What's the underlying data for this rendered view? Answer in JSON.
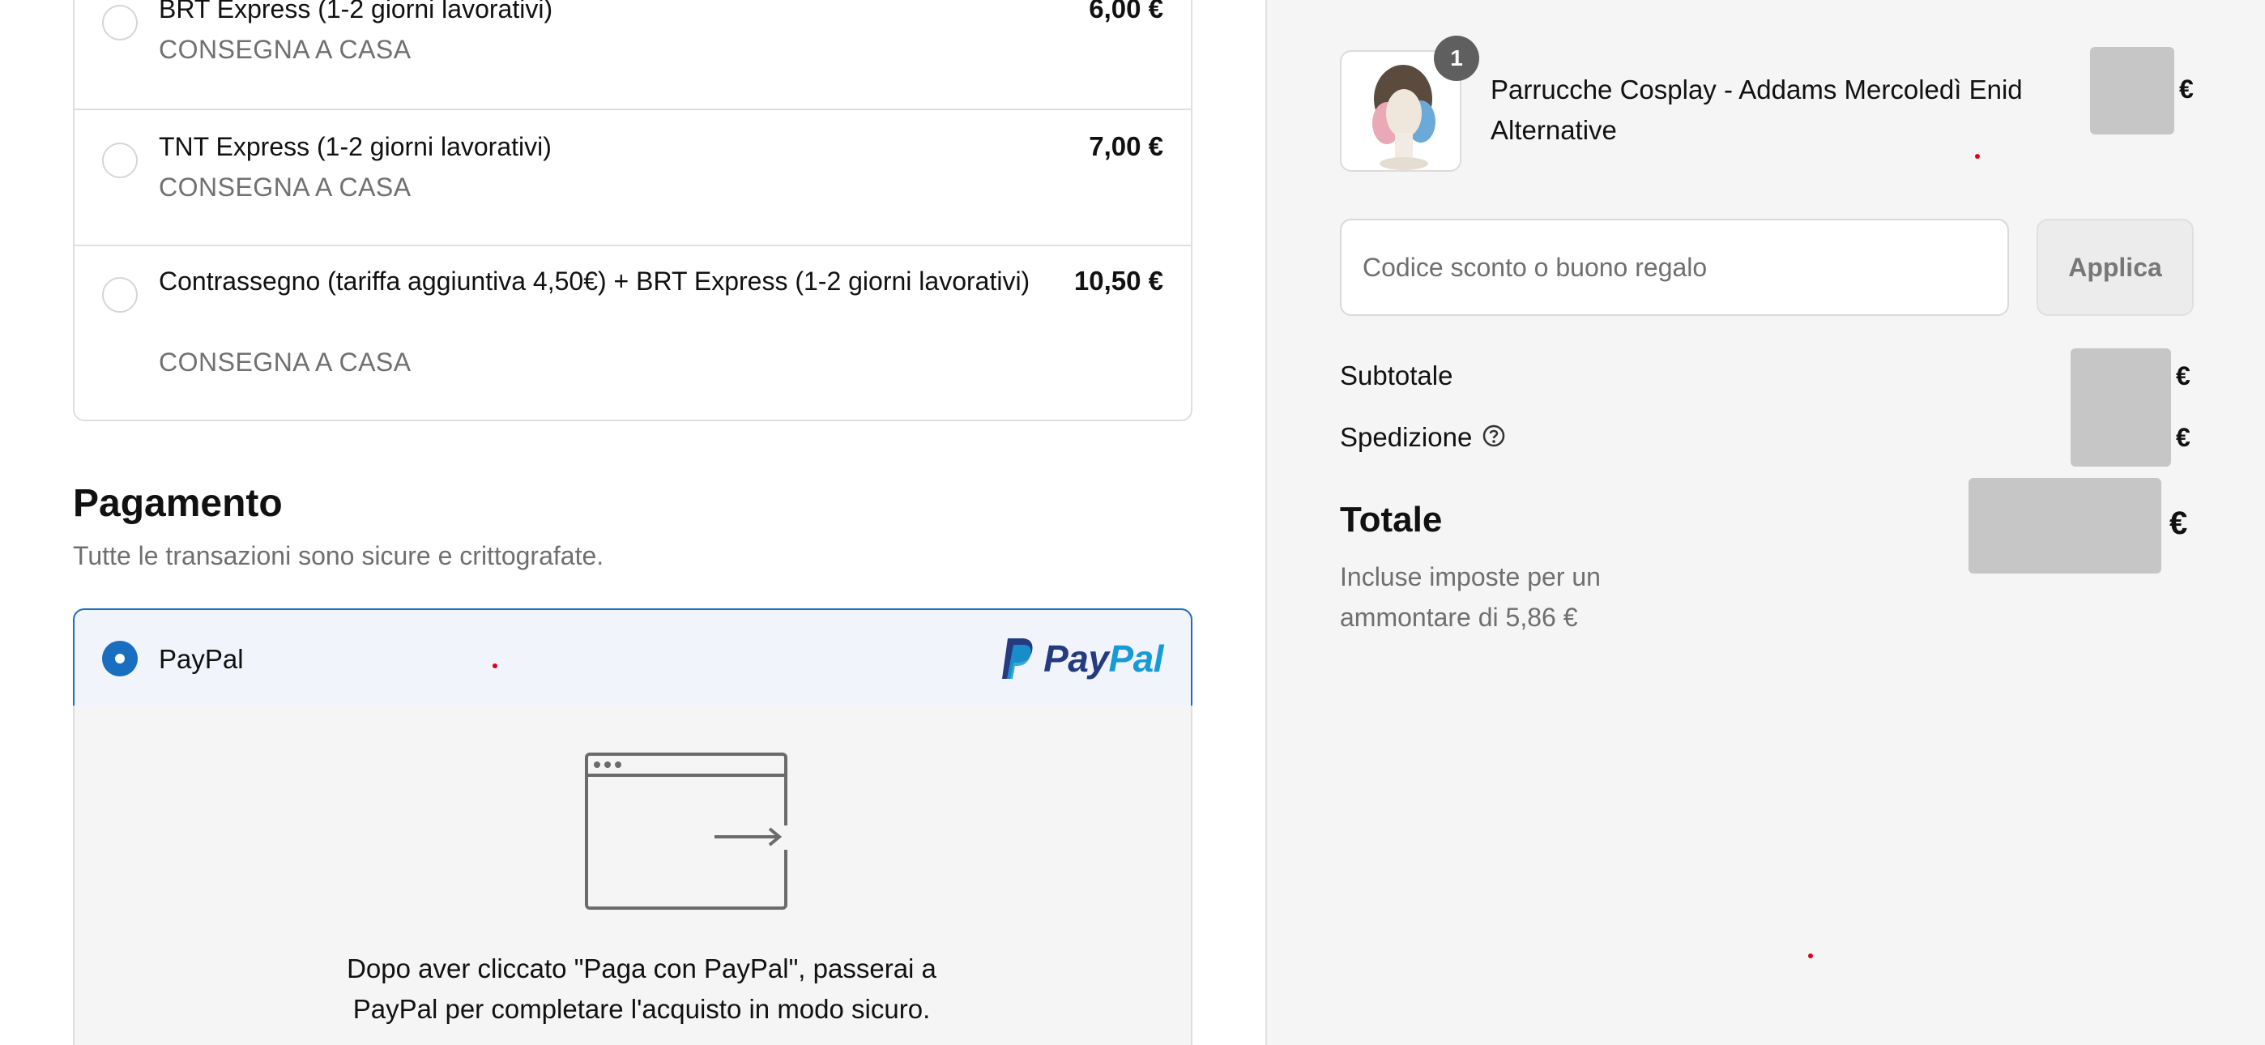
{
  "shipping": {
    "options": [
      {
        "title": "BRT Express (1-2 giorni lavorativi)",
        "subtitle": "CONSEGNA A CASA",
        "price": "6,00 €",
        "selected": false
      },
      {
        "title": "TNT Express (1-2 giorni lavorativi)",
        "subtitle": "CONSEGNA A CASA",
        "price": "7,00 €",
        "selected": false
      },
      {
        "title": "Contrassegno (tariffa aggiuntiva 4,50€) + BRT Express (1-2 giorni lavorativi)",
        "subtitle": "CONSEGNA A CASA",
        "price": "10,50 €",
        "selected": false
      }
    ]
  },
  "payment": {
    "heading": "Pagamento",
    "subheading": "Tutte le transazioni sono sicure e crittografate.",
    "method_label": "PayPal",
    "logo_text_pay": "Pay",
    "logo_text_pal": "Pal",
    "redirect_note": "Dopo aver cliccato \"Paga con PayPal\", passerai a PayPal per completare l'acquisto in modo sicuro."
  },
  "summary": {
    "product": {
      "name": "Parrucche Cosplay - Addams Mercoledì Enid Alternative",
      "quantity": "1",
      "currency": "€"
    },
    "discount": {
      "placeholder": "Codice sconto o buono regalo",
      "apply_label": "Applica"
    },
    "subtotal_label": "Subtotale",
    "subtotal_currency": "€",
    "shipping_label": "Spedizione",
    "shipping_currency": "€",
    "total_label": "Totale",
    "total_currency": "€",
    "tax_note": "Incluse imposte per un ammontare di 5,86 €"
  },
  "colors": {
    "accent": "#1a6ec0",
    "paypal_dark": "#253b80",
    "paypal_light": "#179bd7",
    "redacted": "#c6c6c6"
  },
  "icons": [
    "radio-icon",
    "paypal-logo-icon",
    "browser-redirect-icon",
    "help-circle-icon"
  ]
}
